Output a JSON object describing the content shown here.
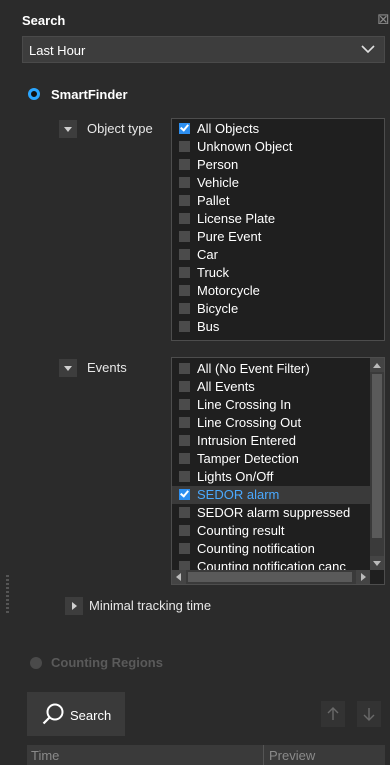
{
  "panel": {
    "title": "Search",
    "close_glyph": "⊠"
  },
  "time_range": {
    "selected": "Last Hour"
  },
  "mode": {
    "smartfinder_label": "SmartFinder",
    "counting_regions_label": "Counting Regions"
  },
  "object_type": {
    "label": "Object type",
    "items": [
      {
        "label": "All Objects",
        "checked": true
      },
      {
        "label": "Unknown Object",
        "checked": false
      },
      {
        "label": "Person",
        "checked": false
      },
      {
        "label": "Vehicle",
        "checked": false
      },
      {
        "label": "Pallet",
        "checked": false
      },
      {
        "label": "License Plate",
        "checked": false
      },
      {
        "label": "Pure Event",
        "checked": false
      },
      {
        "label": "Car",
        "checked": false
      },
      {
        "label": "Truck",
        "checked": false
      },
      {
        "label": "Motorcycle",
        "checked": false
      },
      {
        "label": "Bicycle",
        "checked": false
      },
      {
        "label": "Bus",
        "checked": false
      }
    ]
  },
  "events": {
    "label": "Events",
    "items": [
      {
        "label": "All (No Event Filter)",
        "checked": false
      },
      {
        "label": "All Events",
        "checked": false
      },
      {
        "label": "Line Crossing In",
        "checked": false
      },
      {
        "label": "Line Crossing Out",
        "checked": false
      },
      {
        "label": "Intrusion Entered",
        "checked": false
      },
      {
        "label": "Tamper Detection",
        "checked": false
      },
      {
        "label": "Lights On/Off",
        "checked": false
      },
      {
        "label": "SEDOR alarm",
        "checked": true
      },
      {
        "label": "SEDOR alarm suppressed",
        "checked": false
      },
      {
        "label": "Counting result",
        "checked": false
      },
      {
        "label": "Counting notification",
        "checked": false
      },
      {
        "label": "Counting notification canc",
        "checked": false
      }
    ]
  },
  "tracking": {
    "label": "Minimal tracking time"
  },
  "search_button": {
    "label": "Search"
  },
  "results_table": {
    "columns": [
      "Time",
      "Preview"
    ]
  },
  "colors": {
    "accent": "#2aa6ff",
    "background": "#2b2b2b",
    "highlight_text": "#4aa9ff"
  },
  "icons": [
    "close-icon",
    "chevron-down-icon",
    "search-icon",
    "arrow-up-icon",
    "arrow-down-icon"
  ]
}
